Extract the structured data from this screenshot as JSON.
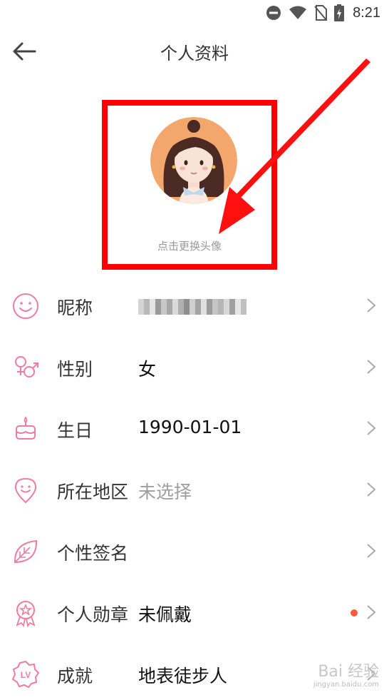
{
  "status_bar": {
    "time": "8:21",
    "icons": [
      "do-not-disturb-icon",
      "wifi-icon",
      "no-sim-icon",
      "battery-charging-icon"
    ]
  },
  "header": {
    "title": "个人资料",
    "back_icon": "back-arrow-icon"
  },
  "avatar": {
    "hint": "点击更换头像"
  },
  "profile_rows": [
    {
      "icon": "smile-icon",
      "label": "昵称",
      "value": "",
      "value_style": "blurred"
    },
    {
      "icon": "gender-icon",
      "label": "性别",
      "value": "女"
    },
    {
      "icon": "cake-icon",
      "label": "生日",
      "value": "1990-01-01"
    },
    {
      "icon": "location-icon",
      "label": "所在地区",
      "value": "未选择",
      "value_style": "muted"
    },
    {
      "icon": "leaf-icon",
      "label": "个性签名",
      "value": ""
    },
    {
      "icon": "medal-icon",
      "label": "个人勋章",
      "value": "未佩戴",
      "badge": "red-dot"
    },
    {
      "icon": "level-icon",
      "label": "成就",
      "value": "地表徒步人"
    }
  ],
  "watermark": {
    "text": "Bai 经验",
    "sub": "jingyan.baidu.com"
  },
  "colors": {
    "accent_pink": "#f07ca0",
    "highlight_red": "#ff0000",
    "badge_red": "#ff5a3c"
  }
}
